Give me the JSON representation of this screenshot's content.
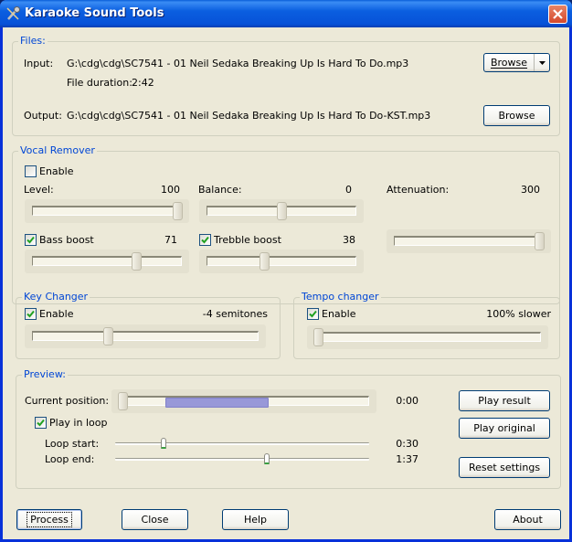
{
  "window": {
    "title": "Karaoke Sound Tools",
    "icon": "microphone-icon"
  },
  "files": {
    "group_label": "Files:",
    "input_label": "Input:",
    "input_path": "G:\\cdg\\cdg\\SC7541 - 01 Neil Sedaka  Breaking Up Is Hard To Do.mp3",
    "duration_label": "File duration:",
    "duration_value": "2:42",
    "output_label": "Output:",
    "output_path": "G:\\cdg\\cdg\\SC7541 - 01 Neil Sedaka  Breaking Up Is Hard To Do-KST.mp3",
    "browse_input_label": "Browse",
    "browse_output_label": "Browse"
  },
  "vocal_remover": {
    "group_label": "Vocal Remover",
    "enable_label": "Enable",
    "enable_checked": false,
    "level_label": "Level:",
    "level_value": "100",
    "level_fraction": 1.0,
    "balance_label": "Balance:",
    "balance_value": "0",
    "balance_fraction": 0.5,
    "attenuation_label": "Attenuation:",
    "attenuation_value": "300",
    "attenuation_fraction": 1.0,
    "bass_label": "Bass boost",
    "bass_checked": true,
    "bass_value": "71",
    "bass_fraction": 0.71,
    "treble_label": "Trebble boost",
    "treble_checked": true,
    "treble_value": "38",
    "treble_fraction": 0.38
  },
  "key_changer": {
    "group_label": "Key Changer",
    "enable_label": "Enable",
    "enable_checked": true,
    "value": "-4 semitones",
    "fraction": 0.33
  },
  "tempo_changer": {
    "group_label": "Tempo changer",
    "enable_label": "Enable",
    "enable_checked": true,
    "value": "100% slower",
    "fraction": 0.0
  },
  "preview": {
    "group_label": "Preview:",
    "position_label": "Current position:",
    "position_value": "0:00",
    "position_fraction": 0.0,
    "loop_region_start_fraction": 0.185,
    "loop_region_end_fraction": 0.6,
    "loop_label": "Play in loop",
    "loop_checked": true,
    "loop_start_label": "Loop start:",
    "loop_start_value": "0:30",
    "loop_start_fraction": 0.185,
    "loop_end_label": "Loop end:",
    "loop_end_value": "1:37",
    "loop_end_fraction": 0.6,
    "play_result_label": "Play result",
    "play_original_label": "Play original",
    "reset_label": "Reset settings"
  },
  "footer": {
    "process_label": "Process",
    "close_label": "Close",
    "help_label": "Help",
    "about_label": "About"
  }
}
